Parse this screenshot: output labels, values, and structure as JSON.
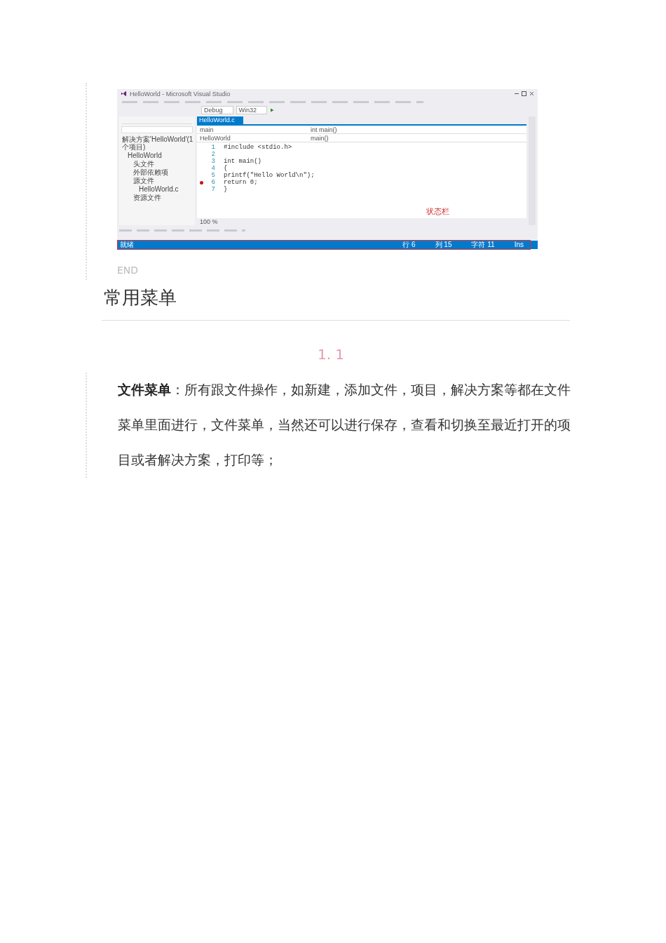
{
  "screenshot": {
    "window_title": "HelloWorld - Microsoft Visual Studio",
    "toolbar": {
      "configuration": "Debug",
      "platform": "Win32"
    },
    "solution_tree": [
      {
        "label": "解决方案'HelloWorld'(1 个项目)",
        "children": [
          {
            "label": "HelloWorld",
            "children": [
              {
                "label": "头文件"
              },
              {
                "label": "外部依赖项"
              },
              {
                "label": "源文件",
                "children": [
                  {
                    "label": "HelloWorld.c"
                  }
                ]
              },
              {
                "label": "资源文件"
              }
            ]
          }
        ]
      }
    ],
    "editor_tab": "HelloWorld.c",
    "nav": [
      "main",
      "int main()",
      "HelloWorld",
      "main()"
    ],
    "code": [
      {
        "num": "1",
        "text": "#include <stdio.h>",
        "breakpoint": false
      },
      {
        "num": "2",
        "breakpoint": false
      },
      {
        "num": "3",
        "text": "int  main()",
        "breakpoint": false
      },
      {
        "num": "4",
        "text": "{",
        "breakpoint": false
      },
      {
        "num": "5",
        "text": "printf(\"Hello World\\n\");",
        "breakpoint": false
      },
      {
        "num": "6",
        "text": "return 0;",
        "breakpoint": true
      },
      {
        "num": "7",
        "text": "}",
        "breakpoint": false
      }
    ],
    "zoom": "100 %",
    "callout": "状态栏",
    "status_bar": {
      "left": "就绪",
      "right": [
        "行 6",
        "列 15",
        "字符 11",
        "Ins"
      ]
    }
  },
  "end_label": "END",
  "heading": "常用菜单",
  "step_number": "1. 1",
  "paragraph": "**文件菜单**：所有跟文件操作，如新建，添加文件，项目，解决方案等都在文件菜单里面进行，文件菜单，当然还可以进行保存，查看和切换至最近打开的项目或者解决方案，打印等；"
}
